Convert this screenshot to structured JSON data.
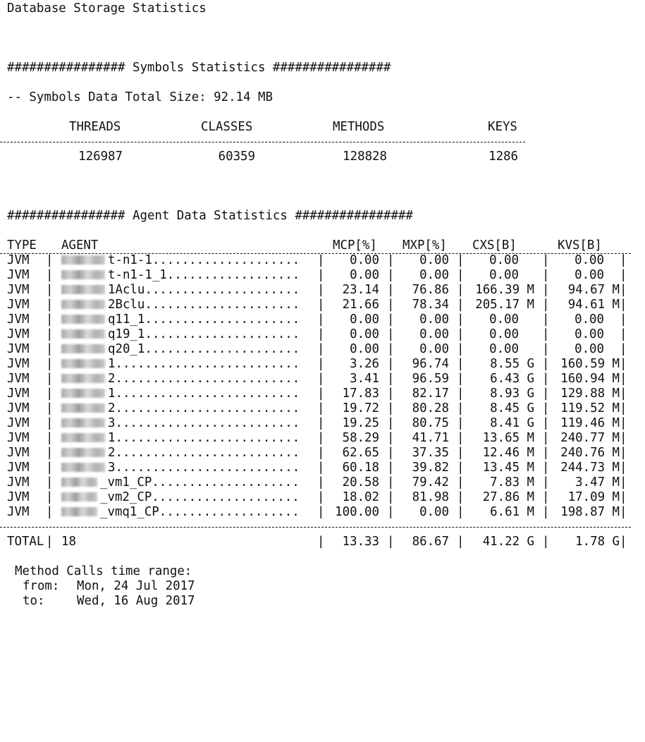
{
  "title": "Database Storage Statistics",
  "symbols": {
    "heading": "################ Symbols Statistics ################",
    "total_size": "-- Symbols Data Total Size: 92.14 MB",
    "headers": [
      "THREADS",
      "CLASSES",
      "METHODS",
      "KEYS"
    ],
    "values": [
      "126987",
      "60359",
      "128828",
      "1286"
    ]
  },
  "agents": {
    "heading": "################ Agent Data Statistics ################",
    "headers": {
      "type": "TYPE",
      "agent": "AGENT",
      "mcp": "MCP[%]",
      "mxp": "MXP[%]",
      "cxs": "CXS[B]",
      "kvs": "KVS[B]"
    },
    "rows": [
      {
        "type": "JVM",
        "agent": "t-n1-1",
        "mcp": "0.00",
        "mxp": "0.00",
        "cxs": "0.00",
        "kvs": "0.00"
      },
      {
        "type": "JVM",
        "agent": "t-n1-1_1",
        "mcp": "0.00",
        "mxp": "0.00",
        "cxs": "0.00",
        "kvs": "0.00"
      },
      {
        "type": "JVM",
        "agent": "1Aclu",
        "mcp": "23.14",
        "mxp": "76.86",
        "cxs": "166.39 M",
        "kvs": "94.67 M"
      },
      {
        "type": "JVM",
        "agent": "2Bclu",
        "mcp": "21.66",
        "mxp": "78.34",
        "cxs": "205.17 M",
        "kvs": "94.61 M"
      },
      {
        "type": "JVM",
        "agent": "q11_1",
        "mcp": "0.00",
        "mxp": "0.00",
        "cxs": "0.00",
        "kvs": "0.00"
      },
      {
        "type": "JVM",
        "agent": "q19_1",
        "mcp": "0.00",
        "mxp": "0.00",
        "cxs": "0.00",
        "kvs": "0.00"
      },
      {
        "type": "JVM",
        "agent": "q20_1",
        "mcp": "0.00",
        "mxp": "0.00",
        "cxs": "0.00",
        "kvs": "0.00"
      },
      {
        "type": "JVM",
        "agent": "1",
        "mcp": "3.26",
        "mxp": "96.74",
        "cxs": "8.55 G",
        "kvs": "160.59 M"
      },
      {
        "type": "JVM",
        "agent": "2",
        "mcp": "3.41",
        "mxp": "96.59",
        "cxs": "6.43 G",
        "kvs": "160.94 M"
      },
      {
        "type": "JVM",
        "agent": "1",
        "mcp": "17.83",
        "mxp": "82.17",
        "cxs": "8.93 G",
        "kvs": "129.88 M"
      },
      {
        "type": "JVM",
        "agent": "2",
        "mcp": "19.72",
        "mxp": "80.28",
        "cxs": "8.45 G",
        "kvs": "119.52 M"
      },
      {
        "type": "JVM",
        "agent": "3",
        "mcp": "19.25",
        "mxp": "80.75",
        "cxs": "8.41 G",
        "kvs": "119.46 M"
      },
      {
        "type": "JVM",
        "agent": "1",
        "mcp": "58.29",
        "mxp": "41.71",
        "cxs": "13.65 M",
        "kvs": "240.77 M"
      },
      {
        "type": "JVM",
        "agent": "2",
        "mcp": "62.65",
        "mxp": "37.35",
        "cxs": "12.46 M",
        "kvs": "240.76 M"
      },
      {
        "type": "JVM",
        "agent": "3",
        "mcp": "60.18",
        "mxp": "39.82",
        "cxs": "13.45 M",
        "kvs": "244.73 M"
      },
      {
        "type": "JVM",
        "agent": "_vm1_CP",
        "mcp": "20.58",
        "mxp": "79.42",
        "cxs": "7.83 M",
        "kvs": "3.47 M"
      },
      {
        "type": "JVM",
        "agent": "_vm2_CP",
        "mcp": "18.02",
        "mxp": "81.98",
        "cxs": "27.86 M",
        "kvs": "17.09 M"
      },
      {
        "type": "JVM",
        "agent": "_vmq1_CP",
        "mcp": "100.00",
        "mxp": "0.00",
        "cxs": "6.61 M",
        "kvs": "198.87 M"
      }
    ],
    "total": {
      "label": "TOTAL",
      "agent": "18",
      "mcp": "13.33",
      "mxp": "86.67",
      "cxs": "41.22 G",
      "kvs": "1.78 G"
    }
  },
  "time_range": {
    "label": "Method Calls time range:",
    "from_label": "from:",
    "from": "Mon, 24 Jul 2017",
    "to_label": "to:",
    "to": "Wed, 16 Aug 2017"
  }
}
